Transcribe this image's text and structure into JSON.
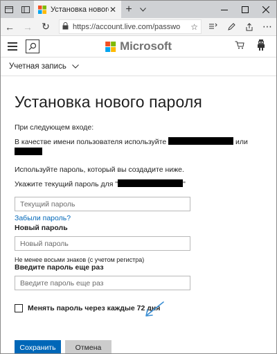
{
  "browser": {
    "tab_title": "Установка нового паро",
    "url": "https://account.live.com/passwo",
    "accent_color": "#0067b8"
  },
  "header": {
    "logo_text": "Microsoft",
    "icons": [
      "hamburger-icon",
      "search-icon",
      "cart-icon",
      "avatar-icon"
    ]
  },
  "account_menu": {
    "label": "Учетная запись"
  },
  "page": {
    "title": "Установка нового пароля",
    "intro": "При следующем входе:",
    "username_text_before": "В качестве имени пользователя используйте",
    "username_text_or": "или",
    "use_password_text": "Используйте пароль, который вы создадите ниже.",
    "current_password_prompt": "Укажите текущий пароль для \"",
    "current_password_prompt_end": "\"",
    "current_password_placeholder": "Текущий пароль",
    "forgot_link": "Забыли пароль?",
    "new_password_label": "Новый пароль",
    "new_password_placeholder": "Новый пароль",
    "new_password_hint": "Не менее восьми знаков (с учетом регистра)",
    "repeat_label": "Введите пароль еще раз",
    "repeat_placeholder": "Введите пароль еще раз",
    "checkbox_label": "Менять пароль через каждые 72 дня",
    "checkbox_checked": false,
    "save_button": "Сохранить",
    "cancel_button": "Отмена"
  }
}
